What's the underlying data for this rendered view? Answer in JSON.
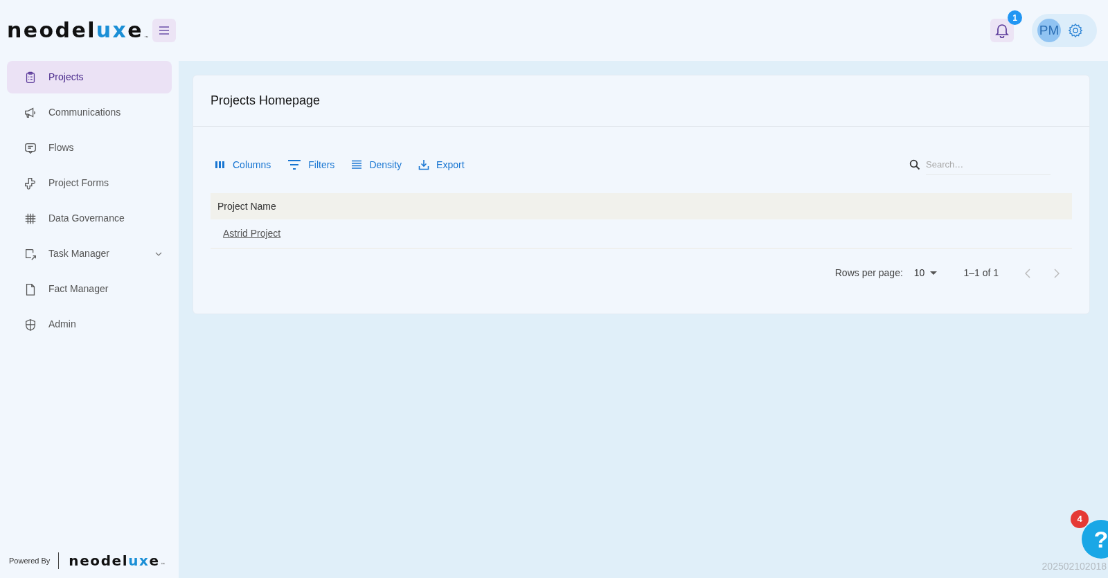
{
  "logo": {
    "parts": [
      {
        "text": "neodel",
        "accent": false
      },
      {
        "text": "ux",
        "accent": true
      },
      {
        "text": "e",
        "accent": false
      }
    ],
    "tm": "™"
  },
  "header": {
    "notifications": {
      "count": "1"
    },
    "avatar": {
      "initials": "PM"
    }
  },
  "sidebar": {
    "items": [
      {
        "label": "Projects",
        "selected": true
      },
      {
        "label": "Communications",
        "selected": false
      },
      {
        "label": "Flows",
        "selected": false
      },
      {
        "label": "Project Forms",
        "selected": false
      },
      {
        "label": "Data Governance",
        "selected": false
      },
      {
        "label": "Task Manager",
        "selected": false,
        "expanded": false
      },
      {
        "label": "Fact Manager",
        "selected": false
      },
      {
        "label": "Admin",
        "selected": false
      }
    ],
    "footer": {
      "label": "Powered By",
      "logo": [
        {
          "text": "neodel",
          "accent": false
        },
        {
          "text": "ux",
          "accent": true
        },
        {
          "text": "e",
          "accent": false
        }
      ],
      "tm": "™"
    }
  },
  "card": {
    "title": "Projects Homepage",
    "toolbar": [
      {
        "label": "Columns"
      },
      {
        "label": "Filters"
      },
      {
        "label": "Density"
      },
      {
        "label": "Export"
      }
    ],
    "search": {
      "placeholder": "Search…"
    },
    "table": {
      "columns": [
        "Project Name"
      ],
      "rows": [
        [
          "Astrid Project"
        ]
      ]
    },
    "pagination": {
      "label": "Rows per page:",
      "rows_per_page": "10",
      "range": "1–1 of 1"
    }
  },
  "help": {
    "badge": "4",
    "label": "?"
  },
  "version": "202502102018"
}
